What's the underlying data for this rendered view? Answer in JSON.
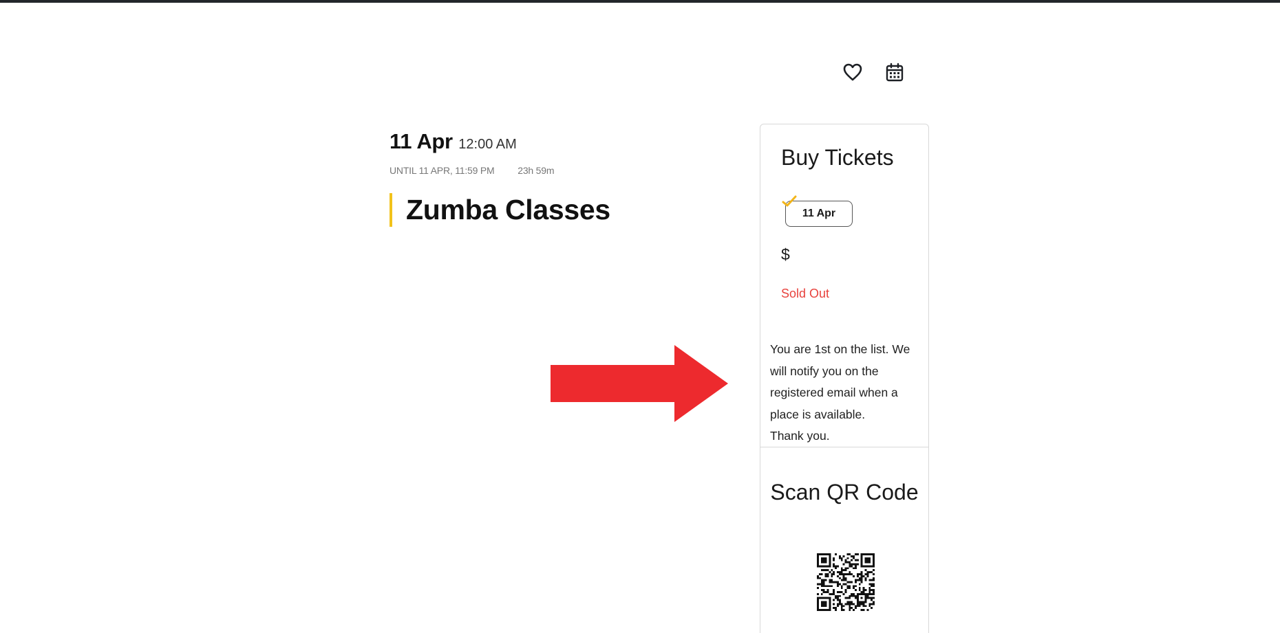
{
  "header": {
    "favorite_icon": "heart-icon",
    "calendar_icon": "calendar-icon"
  },
  "event": {
    "date_day": "11 Apr",
    "date_time": "12:00 AM",
    "until": "UNTIL 11 APR, 11:59 PM",
    "duration": "23h 59m",
    "title": "Zumba Classes",
    "accent_color": "#f2c21b"
  },
  "annotation": {
    "arrow_color": "#ed2a2e",
    "arrow_icon": "right-arrow"
  },
  "tickets": {
    "heading": "Buy Tickets",
    "selected_date": "11 Apr",
    "check_icon": "check-icon",
    "price": "$",
    "status": "Sold Out",
    "status_color": "#e8423d",
    "waitlist_message": "You are 1st on the list. We will notify you on the registered email when a place is available.",
    "thanks": "Thank you."
  },
  "qr": {
    "heading": "Scan QR Code",
    "qr_icon": "qr-code-icon"
  }
}
